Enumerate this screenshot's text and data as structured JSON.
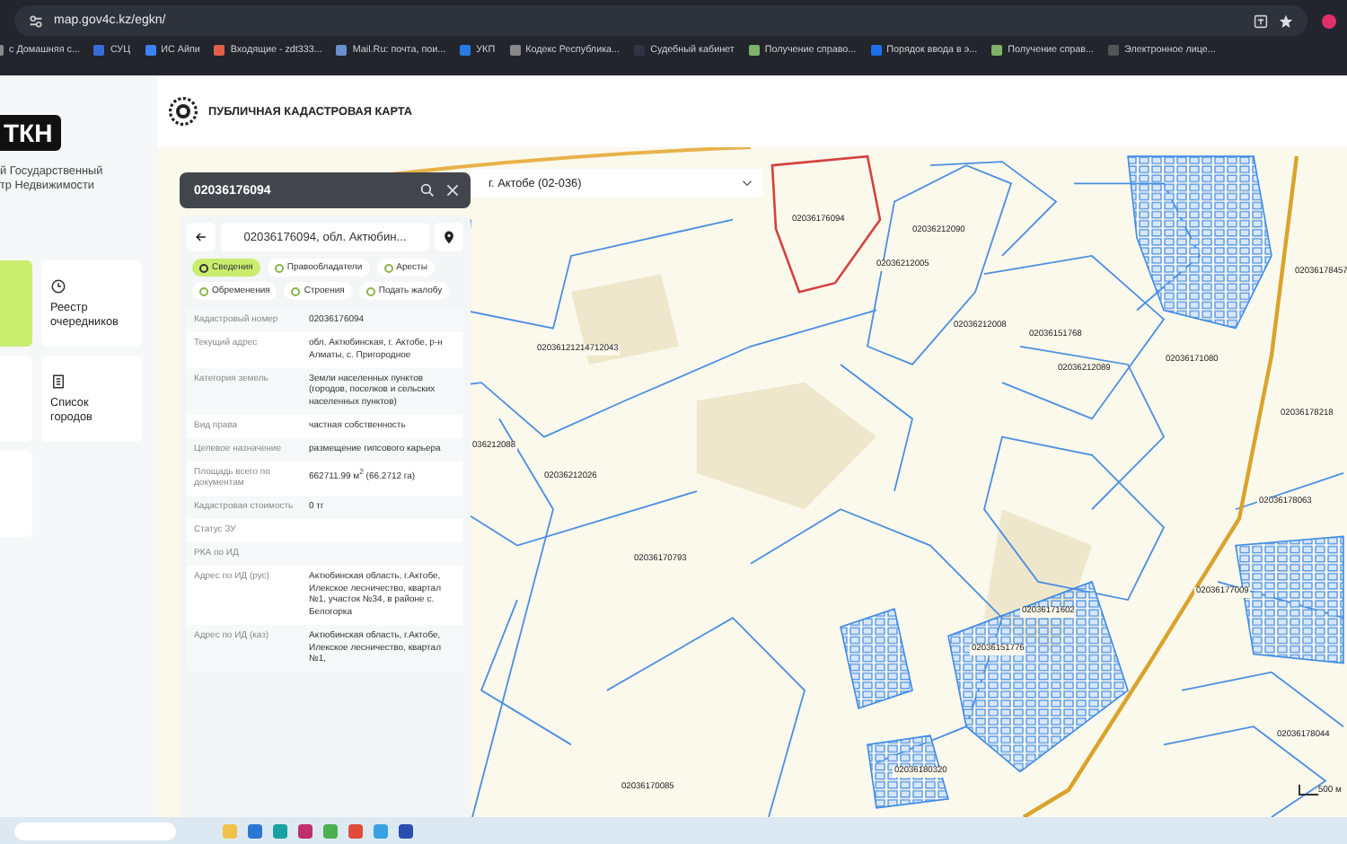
{
  "browser": {
    "url": "map.gov4c.kz/egkn/",
    "bookmarks": [
      "с Домашняя с...",
      "СУЦ",
      "ИС Айпи",
      "Входящие - zdt333...",
      "Mail.Ru: почта, пои...",
      "УКП",
      "Кодекс Республика...",
      "Судебный кабинет",
      "Получение справо...",
      "Порядок ввода в э...",
      "Получение справ...",
      "Электронное лице..."
    ]
  },
  "sidebar": {
    "brand": "ТКН",
    "subtitle": [
      "й Государственный",
      "тр Недвижимости"
    ],
    "cards": [
      {
        "selected": true
      },
      {
        "label": "Реестр очередников",
        "selected": false
      },
      {
        "selected": false
      },
      {
        "label": "Список городов",
        "selected": false
      },
      {
        "selected": false
      }
    ]
  },
  "header": {
    "title": "ПУБЛИЧНАЯ КАДАСТРОВАЯ КАРТА"
  },
  "map": {
    "region": "г. Актобе (02-036)",
    "search": {
      "value": "02036176094"
    },
    "panel": {
      "title": "02036176094, обл. Актюбин...",
      "tabs": [
        {
          "label": "Сведения",
          "selected": true
        },
        {
          "label": "Правообладатели",
          "selected": false
        },
        {
          "label": "Аресты",
          "selected": false
        },
        {
          "label": "Обременения",
          "selected": false
        },
        {
          "label": "Строения",
          "selected": false
        },
        {
          "label": "Подать жалобу",
          "selected": false
        }
      ],
      "rows": [
        {
          "label": "Кадастровый номер",
          "value": "02036176094"
        },
        {
          "label": "Текущий адрес",
          "value": "обл. Актюбинская, г. Актобе, р-н Алматы, с. Пригородное"
        },
        {
          "label": "Категория земель",
          "value": "Земли населенных пунктов (городов, поселков и сельских населенных пунктов)"
        },
        {
          "label": "Вид права",
          "value": "частная собственность"
        },
        {
          "label": "Целевое назначение",
          "value": "размещение гипсового карьера"
        },
        {
          "label": "Площадь всего по документам",
          "value": "662711.99 м$^{2}$ (66.2712 га)"
        },
        {
          "label": "Кадастровая стоимость",
          "value": "0 тг"
        },
        {
          "label": "Статус ЗУ"
        },
        {
          "label": "РКА по ИД"
        },
        {
          "label": "Адрес по ИД (рус)",
          "value": "Актюбинская область, г.Актобе, Илекское лесничество, квартал №1, участок №34, в районе с. Белогорка"
        },
        {
          "label": "Адрес по ИД (каз)",
          "value": "Актюбинская область, г.Актобе, Илекское лесничество, квартал №1,"
        }
      ]
    },
    "parcel_labels": [
      "02036176094",
      "02036212090",
      "02036212005",
      "02036178457",
      "02036212008",
      "02036151768",
      "02036121214712043",
      "02036171080",
      "02036212089",
      "02036178218",
      "036212088",
      "02036212026",
      "02036178063",
      "02036170793",
      "02036177009",
      "02036171602",
      "02036151776",
      "02036178044",
      "02036180320",
      "02036170085"
    ],
    "scale": "500 м"
  }
}
